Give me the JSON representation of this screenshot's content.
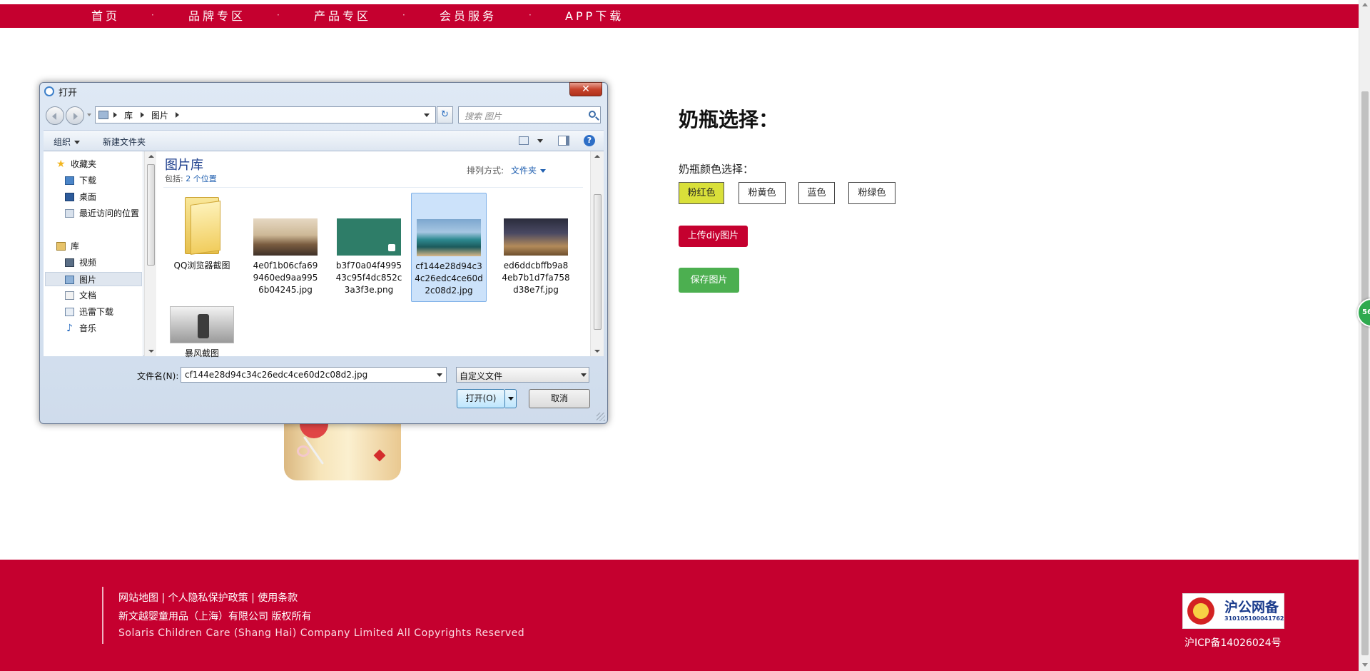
{
  "nav": {
    "items": [
      "首页",
      "品牌专区",
      "产品专区",
      "会员服务",
      "APP下载"
    ],
    "separator": "·"
  },
  "side_badge": "56",
  "panel": {
    "title": "奶瓶选择：",
    "color_label": "奶瓶颜色选择：",
    "colors": [
      "粉红色",
      "粉黄色",
      "蓝色",
      "粉绿色"
    ],
    "selected_color": "粉红色",
    "upload_label": "上传diy图片",
    "save_label": "保存图片"
  },
  "footer": {
    "links": "网站地图 | 个人隐私保护政策 | 使用条款",
    "company": "新文越婴童用品（上海）有限公司 版权所有",
    "copyright": "Solaris Children Care (Shang Hai) Company Limited All Copyrights Reserved",
    "police_title": "沪公网备",
    "police_number": "310105100041762",
    "icp": "沪ICP备14026024号"
  },
  "dialog": {
    "title": "打开",
    "close_label": "✕",
    "breadcrumb": [
      "库",
      "图片"
    ],
    "refresh_glyph": "↻",
    "search_placeholder": "搜索 图片",
    "organize_label": "组织",
    "new_folder_label": "新建文件夹",
    "help_glyph": "?",
    "sidebar": {
      "favorites": "收藏夹",
      "favorites_items": [
        "下载",
        "桌面",
        "最近访问的位置"
      ],
      "libraries": "库",
      "library_items": [
        "视频",
        "图片",
        "文档",
        "迅雷下载",
        "音乐"
      ],
      "selected": "图片",
      "star_glyph": "★",
      "music_glyph": "♪"
    },
    "library_title": "图片库",
    "includes_label": "包括:",
    "includes_value": "2 个位置",
    "sort_label": "排列方式:",
    "sort_value": "文件夹",
    "files": [
      {
        "name": "QQ浏览器截图",
        "kind": "folder"
      },
      {
        "name": "4e0f1b06cfa699460ed9aa9956b04245.jpg",
        "kind": "image"
      },
      {
        "name": "b3f70a04f499543c95f4dc852c3a3f3e.png",
        "kind": "image"
      },
      {
        "name": "cf144e28d94c34c26edc4ce60d2c08d2.jpg",
        "kind": "image",
        "selected": true
      },
      {
        "name": "ed6ddcbffb9a84eb7b1d7fa758d38e7f.jpg",
        "kind": "image"
      },
      {
        "name": "暴风截图",
        "kind": "folder"
      }
    ],
    "filename_label": "文件名(N):",
    "filename_value": "cf144e28d94c34c26edc4ce60d2c08d2.jpg",
    "filetype_value": "自定义文件",
    "open_label": "打开(O)",
    "cancel_label": "取消"
  },
  "colors": {
    "brand_red": "#c5002f",
    "selected_yellow": "#d9e03a",
    "save_green": "#4caf50"
  }
}
